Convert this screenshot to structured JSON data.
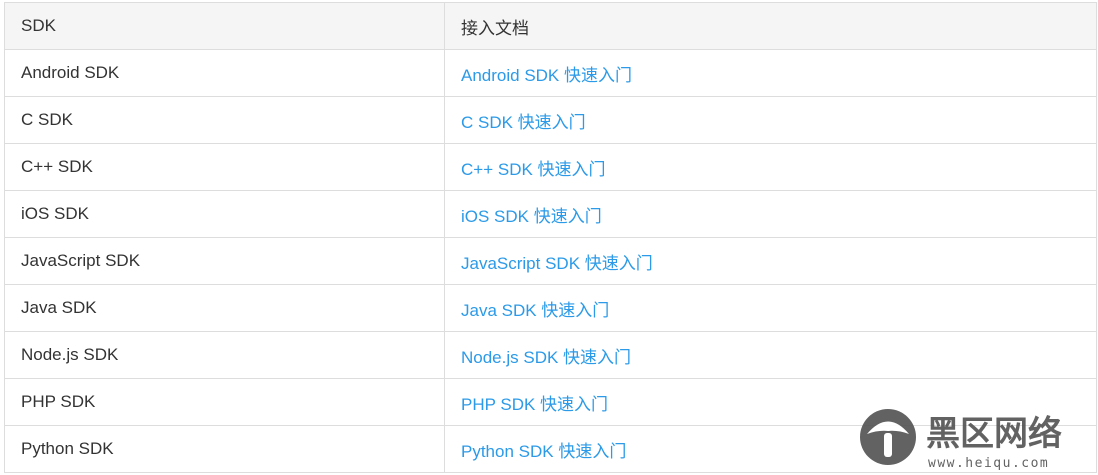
{
  "table": {
    "headers": {
      "sdk": "SDK",
      "docs": "接入文档"
    },
    "rows": [
      {
        "sdk": "Android SDK",
        "doc": "Android SDK 快速入门"
      },
      {
        "sdk": "C SDK",
        "doc": "C SDK 快速入门"
      },
      {
        "sdk": "C++ SDK",
        "doc": "C++ SDK 快速入门"
      },
      {
        "sdk": "iOS SDK",
        "doc": "iOS SDK 快速入门"
      },
      {
        "sdk": "JavaScript SDK",
        "doc": "JavaScript SDK 快速入门"
      },
      {
        "sdk": "Java SDK",
        "doc": "Java SDK 快速入门"
      },
      {
        "sdk": "Node.js SDK",
        "doc": "Node.js SDK 快速入门"
      },
      {
        "sdk": "PHP SDK",
        "doc": "PHP SDK 快速入门"
      },
      {
        "sdk": "Python SDK",
        "doc": "Python SDK 快速入门"
      }
    ]
  },
  "watermark": {
    "title": "黑区网络",
    "url": "www.heiqu.com"
  },
  "colors": {
    "link": "#2b9ae8",
    "header_bg": "#f5f5f5",
    "border": "#dddddd",
    "text": "#333333"
  }
}
